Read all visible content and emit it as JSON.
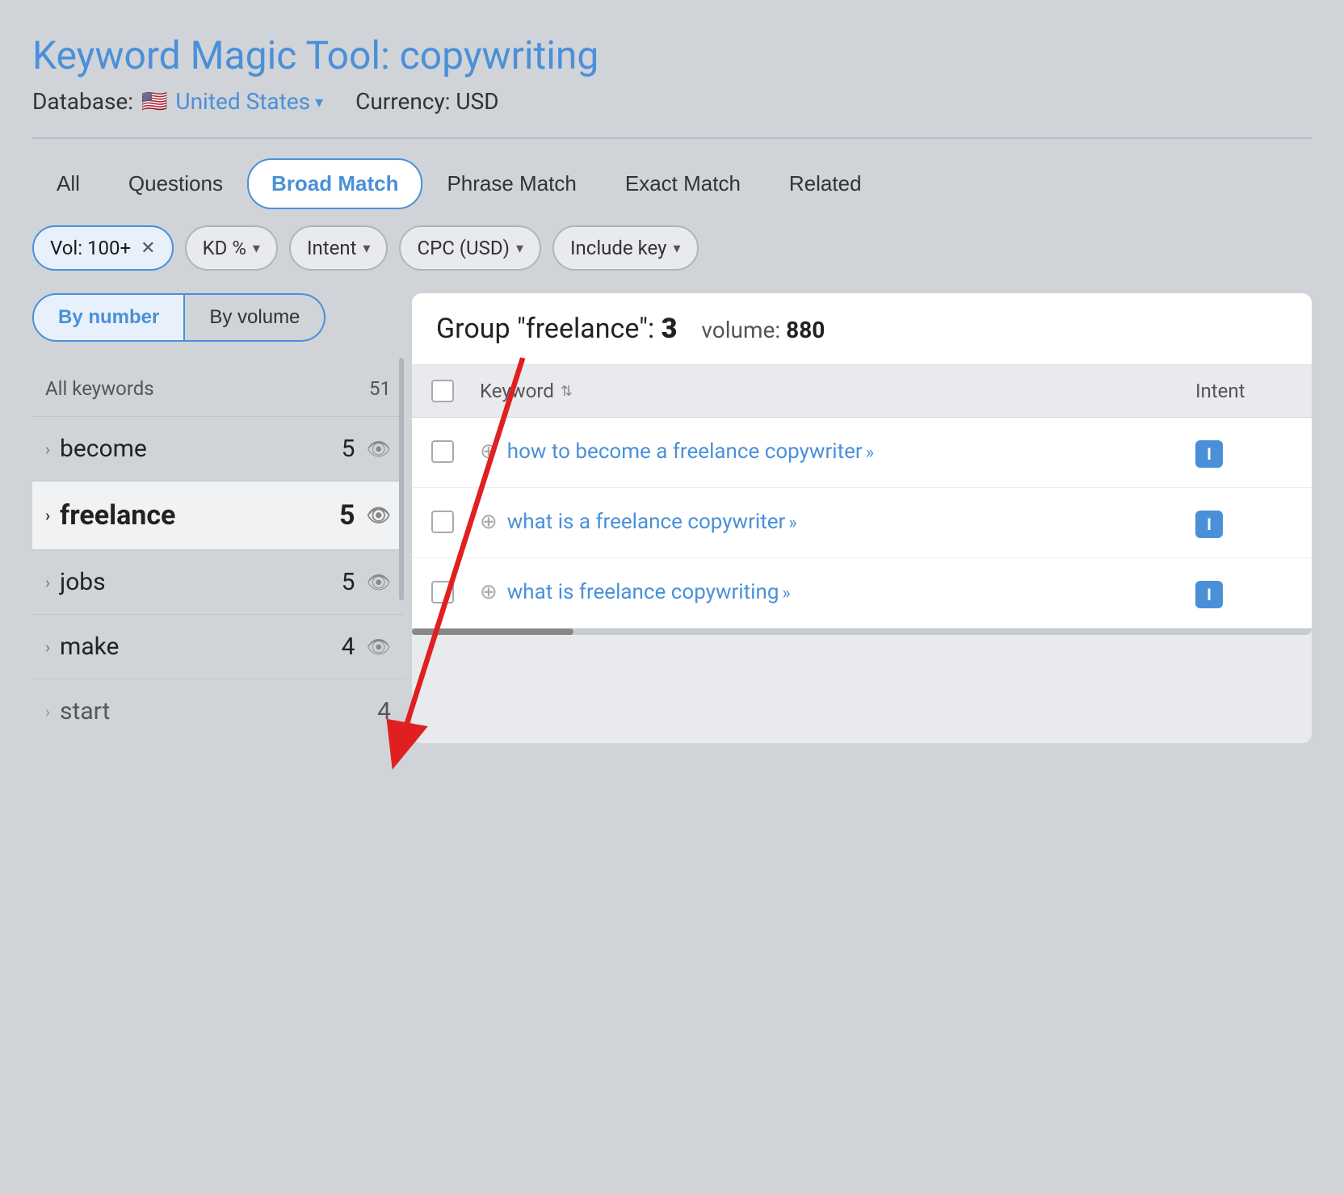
{
  "header": {
    "title_prefix": "Keyword Magic Tool: ",
    "title_keyword": "copywriting",
    "database_label": "Database:",
    "country_flag": "🇺🇸",
    "country_name": "United States",
    "currency_label": "Currency: USD"
  },
  "tabs": [
    {
      "label": "All",
      "active": false
    },
    {
      "label": "Questions",
      "active": false
    },
    {
      "label": "Broad Match",
      "active": true
    },
    {
      "label": "Phrase Match",
      "active": false
    },
    {
      "label": "Exact Match",
      "active": false
    },
    {
      "label": "Related",
      "active": false
    }
  ],
  "filters": [
    {
      "label": "Vol: 100+",
      "type": "active-with-close",
      "active": true
    },
    {
      "label": "KD %",
      "type": "dropdown",
      "active": false
    },
    {
      "label": "Intent",
      "type": "dropdown",
      "active": false
    },
    {
      "label": "CPC (USD)",
      "type": "dropdown",
      "active": false
    },
    {
      "label": "Include key",
      "type": "dropdown",
      "active": false
    }
  ],
  "sort_buttons": [
    {
      "label": "By number",
      "active": true
    },
    {
      "label": "By volume",
      "active": false
    }
  ],
  "sidebar": {
    "header": {
      "label": "All keywords",
      "count": "51"
    },
    "items": [
      {
        "label": "become",
        "count": "5",
        "selected": false
      },
      {
        "label": "freelance",
        "count": "5",
        "selected": true
      },
      {
        "label": "jobs",
        "count": "5",
        "selected": false
      },
      {
        "label": "make",
        "count": "4",
        "selected": false
      },
      {
        "label": "start",
        "count": "4",
        "selected": false
      }
    ]
  },
  "panel": {
    "tooltip_text": "Group \"freelance\": 3",
    "volume_label": "volume:",
    "volume_value": "880",
    "table_headers": {
      "keyword": "Keyword",
      "intent": "Intent"
    },
    "rows": [
      {
        "keyword": "how to become a freelance copywriter",
        "intent": "I"
      },
      {
        "keyword": "what is a freelance copywriter",
        "intent": "I"
      },
      {
        "keyword": "what is freelance copywriting",
        "intent": "I"
      }
    ]
  },
  "annotation": {
    "arrow_label": "arrow pointing to freelance group"
  }
}
